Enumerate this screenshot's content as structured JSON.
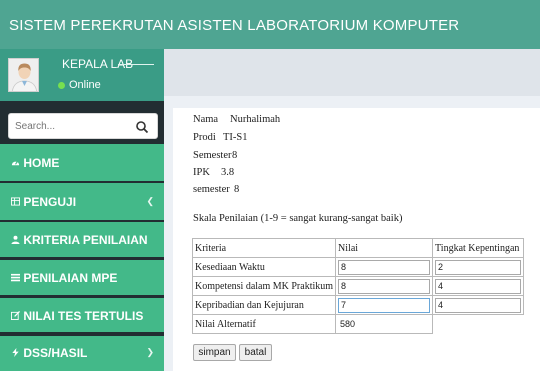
{
  "app": {
    "title": "SISTEM PEREKRUTAN ASISTEN LABORATORIUM KOMPUTER"
  },
  "user": {
    "name": "KEPALA LAB",
    "status": "Online"
  },
  "search": {
    "placeholder": "Search..."
  },
  "sidebar": {
    "items": [
      {
        "label": "HOME",
        "icon": "dashboard-icon",
        "has_chevron": false
      },
      {
        "label": "PENGUJI",
        "icon": "table-icon",
        "has_chevron": true
      },
      {
        "label": "KRITERIA PENILAIAN",
        "icon": "user-icon",
        "has_chevron": false
      },
      {
        "label": "PENILAIAN MPE",
        "icon": "list-icon",
        "has_chevron": false
      },
      {
        "label": "NILAI TES TERTULIS",
        "icon": "edit-icon",
        "has_chevron": false
      },
      {
        "label": "DSS/HASIL",
        "icon": "lightning-icon",
        "has_chevron": true
      }
    ]
  },
  "student": {
    "nama_label": "Nama",
    "nama_value": "Nurhalimah",
    "prodi_label": "Prodi",
    "prodi_value": "TI-S1",
    "semester_label": "Semester",
    "semester_value": "8",
    "ipk_label": "IPK",
    "ipk_value": "3.8",
    "semester2_label": "semester",
    "semester2_value": "8"
  },
  "scale_text": "Skala Penilaian (1-9 = sangat kurang-sangat baik)",
  "table": {
    "headers": [
      "Kriteria",
      "Nilai",
      "Tingkat Kepentingan"
    ],
    "rows": [
      {
        "kriteria": "Kesediaan Waktu",
        "nilai": "8",
        "tingkat": "2"
      },
      {
        "kriteria": "Kompetensi dalam MK Praktikum",
        "nilai": "8",
        "tingkat": "4"
      },
      {
        "kriteria": "Kepribadian dan Kejujuran",
        "nilai": "7",
        "tingkat": "4"
      }
    ],
    "alternatif_label": "Nilai Alternatif",
    "alternatif_value": "580"
  },
  "buttons": {
    "save": "simpan",
    "cancel": "batal"
  },
  "colors": {
    "header": "#4fa592",
    "user_panel": "#3a9c86",
    "menu": "#43b989",
    "sidebar_bg": "#222d32",
    "online": "#77e04f"
  }
}
